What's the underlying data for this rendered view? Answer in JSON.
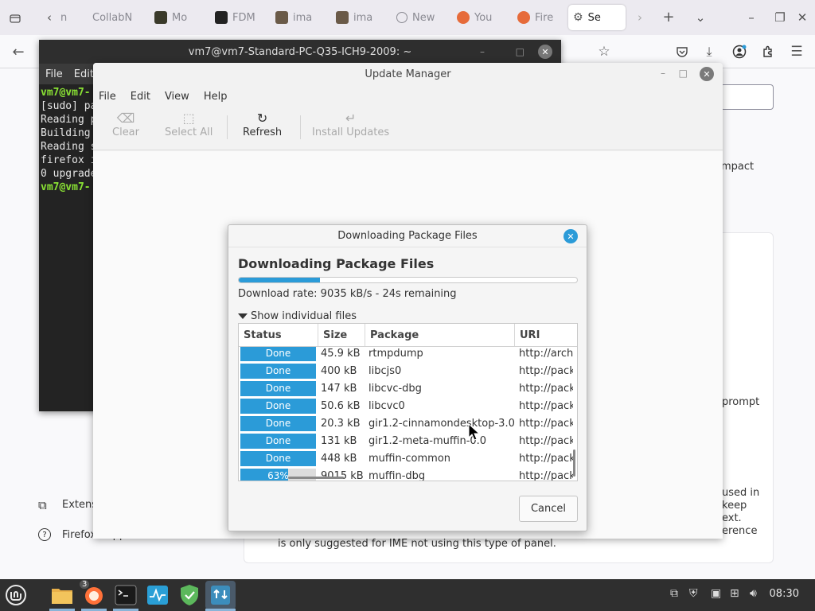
{
  "firefox": {
    "tabs": [
      {
        "label": "n",
        "icon": "firefox-view-icon"
      },
      {
        "label": "CollabN",
        "icon": "collabnet-icon"
      },
      {
        "label": "Mo",
        "icon": "image-thumbnail-icon"
      },
      {
        "label": "FDM",
        "icon": "tiktok-icon"
      },
      {
        "label": "ima",
        "icon": "image-thumbnail-icon"
      },
      {
        "label": "ima",
        "icon": "image-thumbnail-icon"
      },
      {
        "label": "New",
        "icon": "info-icon"
      },
      {
        "label": "You",
        "icon": "firefox-icon"
      },
      {
        "label": "Fire",
        "icon": "firefox-icon"
      },
      {
        "label": "Se",
        "icon": "gear-icon"
      }
    ],
    "page": {
      "impact_fragment": "mpact",
      "prompt_fragment": "prompt",
      "used_in_fragment": "used in",
      "keep_fragment": "keep",
      "ext_fragment": "ext.",
      "erence_fragment": "erence",
      "ime_note": "is only suggested for IME not using this type of panel.",
      "extensions_label": "Extens",
      "support_label": "Firefox Support"
    }
  },
  "terminal": {
    "title": "vm7@vm7-Standard-PC-Q35-ICH9-2009: ~",
    "menu": [
      "File",
      "Edit"
    ],
    "lines": [
      {
        "text": "vm7@vm7-",
        "green": true
      },
      {
        "text": "[sudo] pa",
        "green": false
      },
      {
        "text": "Reading p",
        "green": false
      },
      {
        "text": "Building",
        "green": false
      },
      {
        "text": "Reading s",
        "green": false
      },
      {
        "text": "firefox i",
        "green": false
      },
      {
        "text": "0 upgrade",
        "green": false
      },
      {
        "text": "vm7@vm7-",
        "green": true
      }
    ]
  },
  "update_manager": {
    "title": "Update Manager",
    "menu": [
      "File",
      "Edit",
      "View",
      "Help"
    ],
    "toolbar": {
      "clear": "Clear",
      "select_all": "Select All",
      "refresh": "Refresh",
      "install": "Install Updates"
    }
  },
  "dialog": {
    "title": "Downloading Package Files",
    "heading": "Downloading Package Files",
    "progress": 0.24,
    "rate_text": "Download rate: 9035 kB/s - 24s remaining",
    "expander_label": "Show individual files",
    "columns": [
      "Status",
      "Size",
      "Package",
      "URI"
    ],
    "rows": [
      {
        "status": "Done",
        "progress": 1.0,
        "size": "45.9 kB",
        "package": "rtmpdump",
        "uri": "http://archiv"
      },
      {
        "status": "Done",
        "progress": 1.0,
        "size": "400 kB",
        "package": "libcjs0",
        "uri": "http://packa"
      },
      {
        "status": "Done",
        "progress": 1.0,
        "size": "147 kB",
        "package": "libcvc-dbg",
        "uri": "http://packa"
      },
      {
        "status": "Done",
        "progress": 1.0,
        "size": "50.6 kB",
        "package": "libcvc0",
        "uri": "http://packa"
      },
      {
        "status": "Done",
        "progress": 1.0,
        "size": "20.3 kB",
        "package": "gir1.2-cinnamondesktop-3.0",
        "uri": "http://packa"
      },
      {
        "status": "Done",
        "progress": 1.0,
        "size": "131 kB",
        "package": "gir1.2-meta-muffin-0.0",
        "uri": "http://packa"
      },
      {
        "status": "Done",
        "progress": 1.0,
        "size": "448 kB",
        "package": "muffin-common",
        "uri": "http://packa"
      },
      {
        "status": "63%",
        "progress": 0.63,
        "size": "9015 kB",
        "package": "muffin-dbg",
        "uri": "http://packa"
      }
    ],
    "cancel_label": "Cancel"
  },
  "panel": {
    "firefox_badge": "3",
    "clock": "08:30"
  },
  "colors": {
    "accent": "#2b9bd8",
    "terminal_green": "#8ae234",
    "panel_bg": "#2f2f2f"
  }
}
